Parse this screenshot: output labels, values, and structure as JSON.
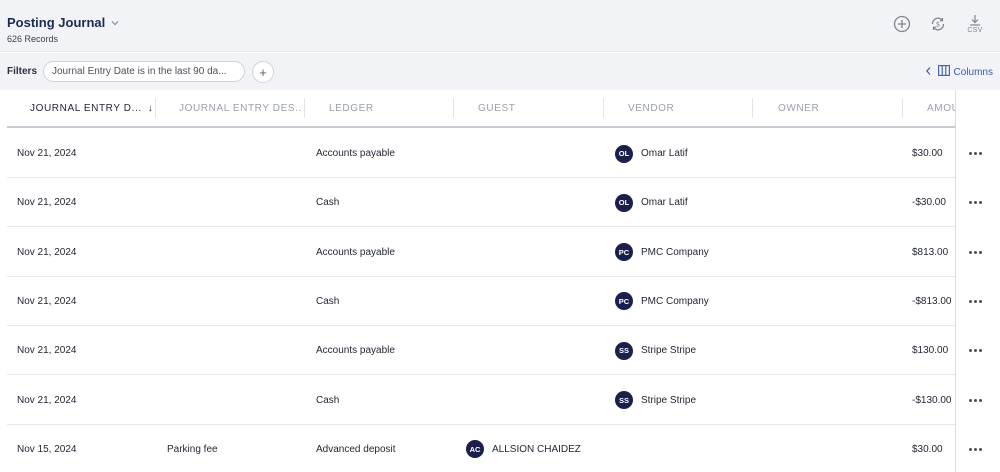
{
  "header": {
    "title": "Posting Journal",
    "records": "626 Records",
    "icons": [
      "add-circle-icon",
      "sync-dollar-icon",
      "download-csv-icon"
    ],
    "csv_label": "CSV"
  },
  "filters": {
    "label": "Filters",
    "chip": "Journal Entry Date is in the last 90 da...",
    "add": "+",
    "columns_label": "Columns"
  },
  "table": {
    "columns": [
      "JOURNAL ENTRY D...",
      "JOURNAL ENTRY DES...",
      "LEDGER",
      "GUEST",
      "VENDOR",
      "OWNER",
      "AMOU"
    ],
    "sort_indicator": "↓",
    "rows": [
      {
        "date": "Nov 21, 2024",
        "desc": "",
        "ledger": "Accounts payable",
        "guest_initials": "",
        "guest": "",
        "vendor_initials": "OL",
        "vendor": "Omar Latif",
        "owner": "",
        "amount": "$30.00"
      },
      {
        "date": "Nov 21, 2024",
        "desc": "",
        "ledger": "Cash",
        "guest_initials": "",
        "guest": "",
        "vendor_initials": "OL",
        "vendor": "Omar Latif",
        "owner": "",
        "amount": "-$30.00"
      },
      {
        "date": "Nov 21, 2024",
        "desc": "",
        "ledger": "Accounts payable",
        "guest_initials": "",
        "guest": "",
        "vendor_initials": "PC",
        "vendor": "PMC Company",
        "owner": "",
        "amount": "$813.00"
      },
      {
        "date": "Nov 21, 2024",
        "desc": "",
        "ledger": "Cash",
        "guest_initials": "",
        "guest": "",
        "vendor_initials": "PC",
        "vendor": "PMC Company",
        "owner": "",
        "amount": "-$813.00"
      },
      {
        "date": "Nov 21, 2024",
        "desc": "",
        "ledger": "Accounts payable",
        "guest_initials": "",
        "guest": "",
        "vendor_initials": "SS",
        "vendor": "Stripe Stripe",
        "owner": "",
        "amount": "$130.00"
      },
      {
        "date": "Nov 21, 2024",
        "desc": "",
        "ledger": "Cash",
        "guest_initials": "",
        "guest": "",
        "vendor_initials": "SS",
        "vendor": "Stripe Stripe",
        "owner": "",
        "amount": "-$130.00"
      },
      {
        "date": "Nov 15, 2024",
        "desc": "Parking fee",
        "ledger": "Advanced deposit",
        "guest_initials": "AC",
        "guest": "ALLSION CHAIDEZ",
        "vendor_initials": "",
        "vendor": "",
        "owner": "",
        "amount": "$30.00"
      }
    ]
  },
  "colors": {
    "header_bg": "#f1f3f6",
    "title": "#1c2a52",
    "avatar_bg": "#1a1f4d",
    "link": "#3b5bb0"
  }
}
